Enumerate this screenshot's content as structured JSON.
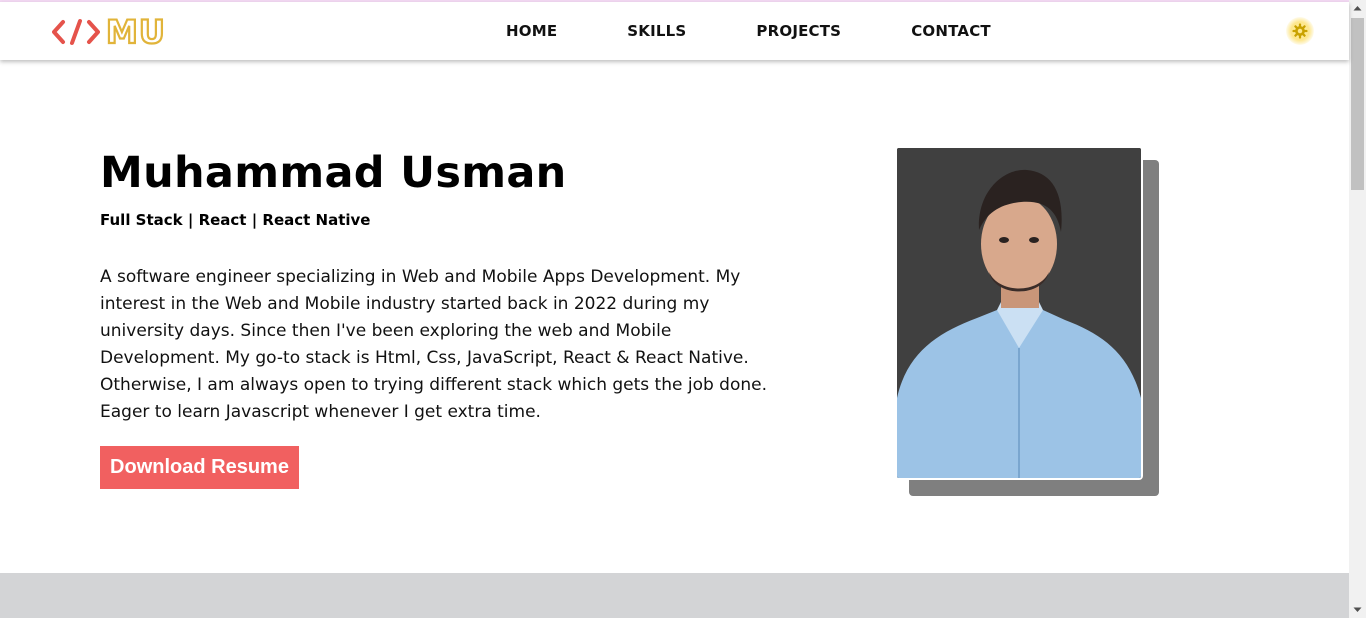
{
  "brand": {
    "initials": "MU",
    "code_symbol": "</>"
  },
  "nav": {
    "items": [
      {
        "label": "HOME"
      },
      {
        "label": "SKILLS"
      },
      {
        "label": "PROJECTS"
      },
      {
        "label": "CONTACT"
      }
    ],
    "theme_icon": "gear-icon"
  },
  "hero": {
    "name": "Muhammad Usman",
    "roles": "Full Stack | React | React Native",
    "bio": "A software engineer specializing in Web and Mobile Apps Development. My interest in the Web and Mobile industry started back in 2022 during my university days. Since then I've been exploring the web and Mobile Development. My go-to stack is Html, Css, JavaScript, React & React Native. Otherwise, I am always open to trying different stack which gets the job done. Eager to learn Javascript whenever I get extra time.",
    "resume_button": "Download Resume",
    "photo_alt": "Muhammad Usman"
  },
  "colors": {
    "accent": "#f16060",
    "logo_gold": "#e1b43a",
    "logo_red": "#e5534b",
    "photo_bg": "#404040",
    "photo_shadow": "#7f7f7f",
    "section_gray": "#d3d4d6"
  }
}
